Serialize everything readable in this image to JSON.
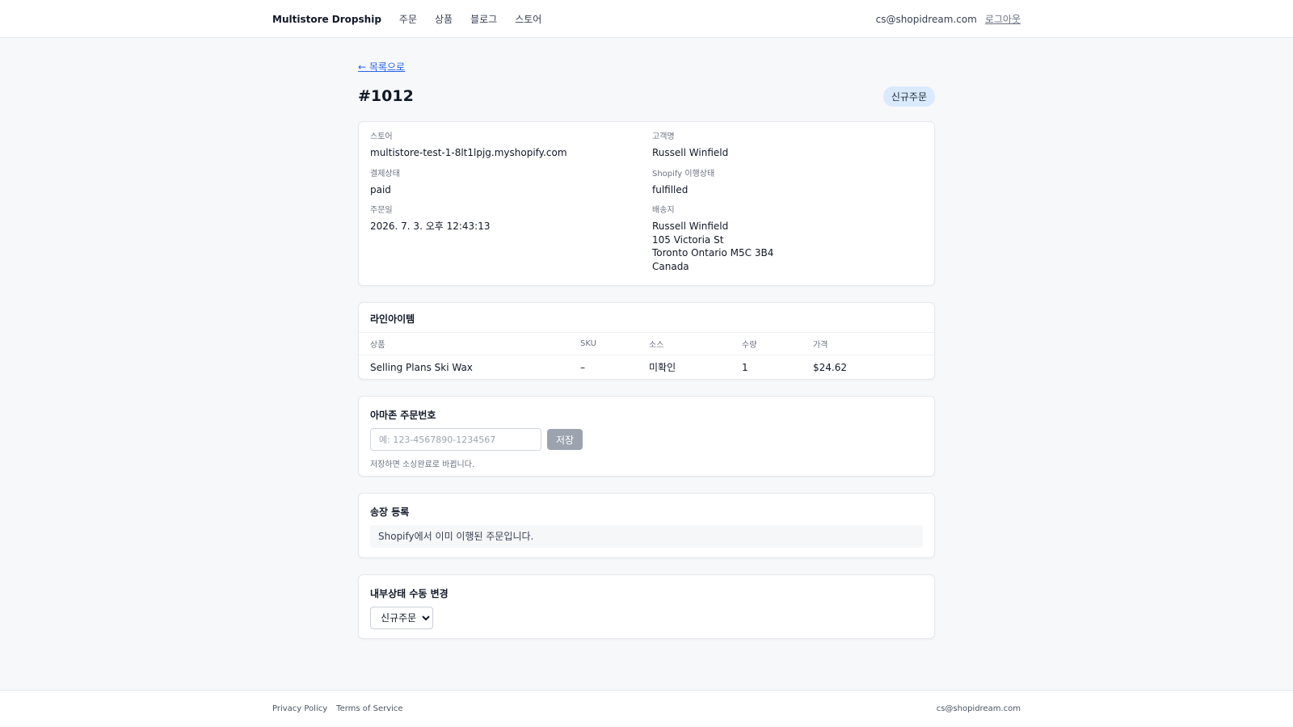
{
  "header": {
    "brand": "Multistore Dropship",
    "nav": [
      "주문",
      "상품",
      "블로그",
      "스토어"
    ],
    "user_email": "cs@shopidream.com",
    "logout": "로그아웃"
  },
  "page": {
    "back": "← 목록으로",
    "title": "#1012",
    "status_badge": "신규주문"
  },
  "order_info": {
    "store_label": "스토어",
    "store_value": "multistore-test-1-8lt1lpjg.myshopify.com",
    "payment_label": "결제상태",
    "payment_value": "paid",
    "order_date_label": "주문일",
    "order_date_value": "2026. 7. 3. 오후 12:43:13",
    "customer_label": "고객명",
    "customer_value": "Russell Winfield",
    "fulfillment_label": "Shopify 이행상태",
    "fulfillment_value": "fulfilled",
    "shipping_label": "배송지",
    "shipping_lines": [
      "Russell Winfield",
      "105 Victoria St",
      "Toronto Ontario M5C 3B4",
      "Canada"
    ]
  },
  "line_items": {
    "title": "라인아이템",
    "columns": [
      "상품",
      "SKU",
      "소스",
      "수량",
      "가격"
    ],
    "rows": [
      {
        "product": "Selling Plans Ski Wax",
        "sku": "–",
        "source": "미확인",
        "qty": "1",
        "price": "$24.62"
      }
    ]
  },
  "amazon": {
    "title": "아마존 주문번호",
    "placeholder": "예: 123-4567890-1234567",
    "save_label": "저장",
    "helper": "저장하면 소싱완료로 바뀝니다."
  },
  "invoice": {
    "title": "송장 등록",
    "notice": "Shopify에서 이미 이행된 주문입니다."
  },
  "manual_status": {
    "title": "내부상태 수동 변경",
    "selected": "신규주문"
  },
  "footer": {
    "privacy": "Privacy Policy",
    "terms": "Terms of Service",
    "email": "cs@shopidream.com"
  },
  "colors": {
    "accent_link": "#2563eb",
    "badge_bg": "#dbeafe",
    "button_disabled": "#9ca3af",
    "page_bg": "#f7f8fa"
  }
}
